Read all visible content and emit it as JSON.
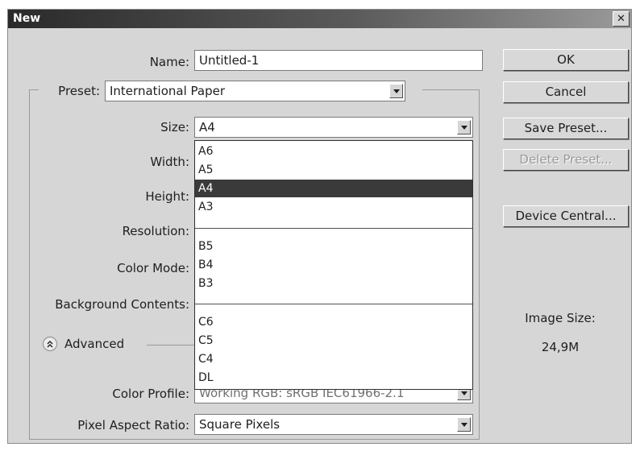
{
  "window": {
    "title": "New",
    "close_glyph": "✕"
  },
  "form": {
    "name_label": "Name:",
    "name_value": "Untitled-1",
    "preset_label": "Preset:",
    "preset_value": "International Paper",
    "size_label": "Size:",
    "size_value": "A4",
    "width_label": "Width:",
    "height_label": "Height:",
    "resolution_label": "Resolution:",
    "color_mode_label": "Color Mode:",
    "background_label": "Background Contents:",
    "advanced_label": "Advanced",
    "color_profile_label": "Color Profile:",
    "color_profile_value": "Working RGB:  sRGB IEC61966-2.1",
    "pixel_aspect_label": "Pixel Aspect Ratio:",
    "pixel_aspect_value": "Square Pixels"
  },
  "size_options": [
    {
      "group": [
        "A6",
        "A5",
        "A4",
        "A3"
      ]
    },
    {
      "group": [
        "B5",
        "B4",
        "B3"
      ]
    },
    {
      "group": [
        "C6",
        "C5",
        "C4",
        "DL"
      ]
    }
  ],
  "size_list": {
    "g1": [
      "A6",
      "A5",
      "A4",
      "A3"
    ],
    "g2": [
      "B5",
      "B4",
      "B3"
    ],
    "g3": [
      "C6",
      "C5",
      "C4",
      "DL"
    ]
  },
  "buttons": {
    "ok": "OK",
    "cancel": "Cancel",
    "save_preset": "Save Preset...",
    "delete_preset": "Delete Preset...",
    "device_central": "Device Central..."
  },
  "image_size": {
    "label": "Image Size:",
    "value": "24,9M"
  },
  "icons": {
    "dropdown": "chevron-down-icon",
    "advanced": "double-chevron-up-icon",
    "close": "close-icon"
  },
  "colors": {
    "title_bar": "#2a2a2a",
    "selected_item": "#3a3a3a",
    "dialog_bg": "#d6d6d6"
  }
}
